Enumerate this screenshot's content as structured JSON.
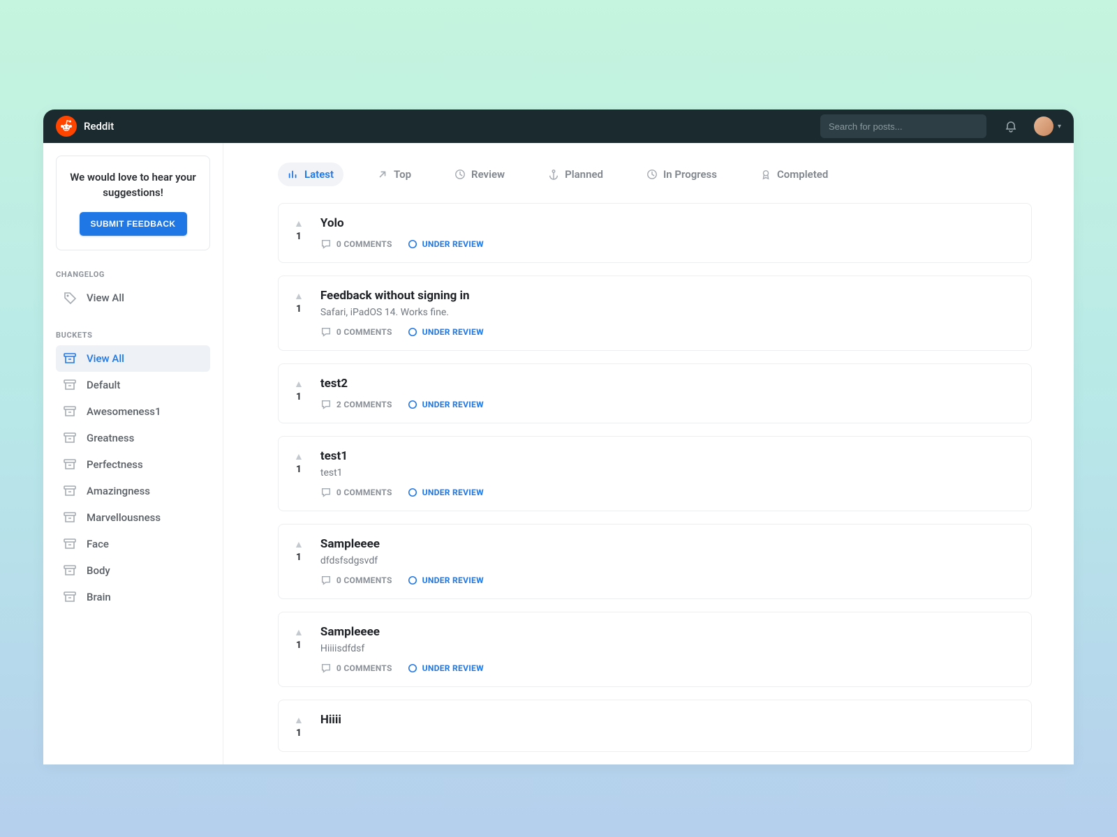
{
  "brand": {
    "name": "Reddit"
  },
  "search": {
    "placeholder": "Search for posts..."
  },
  "sidebar": {
    "feedback_prompt": "We would love to hear your suggestions!",
    "submit_label": "SUBMIT FEEDBACK",
    "changelog_label": "CHANGELOG",
    "changelog_view_all": "View All",
    "buckets_label": "BUCKETS",
    "buckets": [
      {
        "label": "View All",
        "active": true
      },
      {
        "label": "Default"
      },
      {
        "label": "Awesomeness1"
      },
      {
        "label": "Greatness"
      },
      {
        "label": "Perfectness"
      },
      {
        "label": "Amazingness"
      },
      {
        "label": "Marvellousness"
      },
      {
        "label": "Face"
      },
      {
        "label": "Body"
      },
      {
        "label": "Brain"
      }
    ]
  },
  "tabs": [
    {
      "label": "Latest",
      "icon": "bar-chart",
      "active": true
    },
    {
      "label": "Top",
      "icon": "arrow-up-right"
    },
    {
      "label": "Review",
      "icon": "clock"
    },
    {
      "label": "Planned",
      "icon": "anchor"
    },
    {
      "label": "In Progress",
      "icon": "clock"
    },
    {
      "label": "Completed",
      "icon": "award"
    }
  ],
  "posts": [
    {
      "votes": 1,
      "title": "Yolo",
      "body": "",
      "comments": "0 COMMENTS",
      "status": "UNDER REVIEW"
    },
    {
      "votes": 1,
      "title": "Feedback without signing in",
      "body": "Safari, iPadOS 14. Works fine.",
      "comments": "0 COMMENTS",
      "status": "UNDER REVIEW"
    },
    {
      "votes": 1,
      "title": "test2",
      "body": "",
      "comments": "2 COMMENTS",
      "status": "UNDER REVIEW"
    },
    {
      "votes": 1,
      "title": "test1",
      "body": "test1",
      "comments": "0 COMMENTS",
      "status": "UNDER REVIEW"
    },
    {
      "votes": 1,
      "title": "Sampleeee",
      "body": "dfdsfsdgsvdf",
      "comments": "0 COMMENTS",
      "status": "UNDER REVIEW"
    },
    {
      "votes": 1,
      "title": "Sampleeee",
      "body": "Hiiiisdfdsf",
      "comments": "0 COMMENTS",
      "status": "UNDER REVIEW"
    },
    {
      "votes": 1,
      "title": "Hiiii",
      "body": "",
      "comments": "",
      "status": ""
    }
  ]
}
